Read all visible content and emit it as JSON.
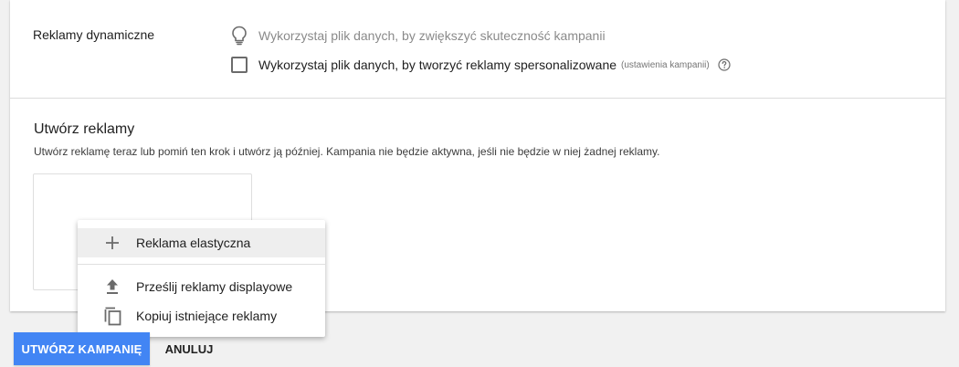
{
  "dynamic_ads": {
    "label": "Reklamy dynamiczne",
    "tip_icon": "lightbulb-icon",
    "tip_text": "Wykorzystaj plik danych, by zwiększyć skuteczność kampanii",
    "checkbox": {
      "checked": false,
      "label": "Wykorzystaj plik danych, by tworzyć reklamy spersonalizowane",
      "link_text": "(ustawienia kampanii)",
      "help_icon": "help-circle-icon"
    }
  },
  "create_ads": {
    "title": "Utwórz reklamy",
    "description": "Utwórz reklamę teraz lub pomiń ten krok i utwórz ją później. Kampania nie będzie aktywna, jeśli nie będzie w niej żadnej reklamy."
  },
  "menu": {
    "items": [
      {
        "icon": "plus-icon",
        "label": "Reklama elastyczna"
      },
      {
        "icon": "upload-icon",
        "label": "Prześlij reklamy displayowe"
      },
      {
        "icon": "copy-icon",
        "label": "Kopiuj istniejące reklamy"
      }
    ]
  },
  "actions": {
    "create_campaign": "UTWÓRZ KAMPANIĘ",
    "cancel": "ANULUJ"
  },
  "colors": {
    "primary": "#4285f4",
    "background": "#f1f1f1",
    "card": "#ffffff"
  }
}
